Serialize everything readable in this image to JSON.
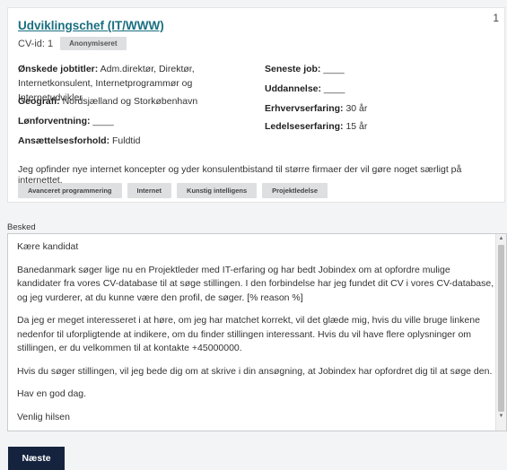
{
  "card": {
    "number": "1",
    "job_title": "Udviklingschef (IT/WWW)",
    "cv_id": "CV-id: 1",
    "anonymized_badge": "Anonymiseret",
    "left_fields": [
      {
        "label": "Ønskede jobtitler:",
        "value": " Adm.direktør, Direktør, Internetkonsulent, Internetprogrammør og Internetudvikler"
      },
      {
        "label": "Geografi:",
        "value": " Nordsjælland og Storkøbenhavn"
      },
      {
        "label": "Lønforventning:",
        "value": " ____"
      },
      {
        "label": "Ansættelsesforhold:",
        "value": " Fuldtid"
      }
    ],
    "right_fields": [
      {
        "label": "Seneste job:",
        "value": " ____"
      },
      {
        "label": "Uddannelse:",
        "value": " ____"
      },
      {
        "label": "Erhvervserfaring:",
        "value": " 30 år"
      },
      {
        "label": "Ledelseserfaring:",
        "value": " 15 år"
      }
    ],
    "description": "Jeg opfinder nye internet koncepter og yder konsulentbistand til større firmaer der vil gøre noget særligt på internettet.",
    "tags": [
      "Avanceret programmering",
      "Internet",
      "Kunstig intelligens",
      "Projektledelse"
    ]
  },
  "message": {
    "label": "Besked",
    "paragraphs": [
      "Kære kandidat",
      "Banedanmark søger lige nu en Projektleder med IT-erfaring og har bedt Jobindex om at opfordre mulige kandidater fra vores CV-database til at søge stillingen. I den forbindelse har jeg fundet dit CV i vores CV-database, og jeg vurderer, at du kunne være den profil, de søger. [% reason %]",
      "Da jeg er meget interesseret i at høre, om jeg har matchet korrekt, vil det glæde mig, hvis du ville bruge linkene nedenfor til uforpligtende at indikere, om du finder stillingen interessant. Hvis du vil have flere oplysninger om stillingen, er du velkommen til at kontakte +45000000.",
      "Hvis du søger stillingen, vil jeg bede dig om at skrive i din ansøgning, at Jobindex har opfordret dig til at søge den.",
      "Hav en god dag.",
      "Venlig hilsen"
    ]
  },
  "next_button": "Næste"
}
